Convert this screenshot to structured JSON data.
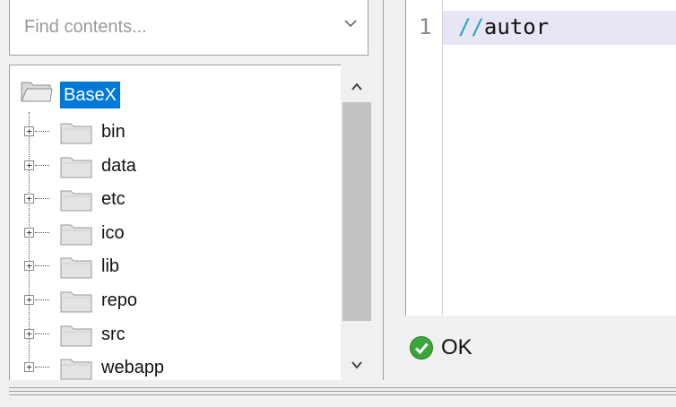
{
  "search": {
    "placeholder": "Find contents..."
  },
  "tree": {
    "root": {
      "label": "BaseX",
      "icon": "open-folder-icon",
      "selected": true
    },
    "items": [
      {
        "label": "bin",
        "icon": "folder-icon"
      },
      {
        "label": "data",
        "icon": "folder-icon"
      },
      {
        "label": "etc",
        "icon": "folder-icon"
      },
      {
        "label": "ico",
        "icon": "folder-icon"
      },
      {
        "label": "lib",
        "icon": "folder-icon"
      },
      {
        "label": "repo",
        "icon": "folder-icon"
      },
      {
        "label": "src",
        "icon": "folder-icon"
      },
      {
        "label": "webapp",
        "icon": "folder-icon"
      }
    ]
  },
  "editor": {
    "line_number": "1",
    "code_operator": "//",
    "code_name": "autor"
  },
  "status": {
    "text": "OK",
    "icon": "check-circle-icon"
  },
  "colors": {
    "selection": "#0078d7",
    "current_line": "#e6e6f5",
    "operator": "#2aa1c8",
    "ok_green": "#3aa63a"
  }
}
